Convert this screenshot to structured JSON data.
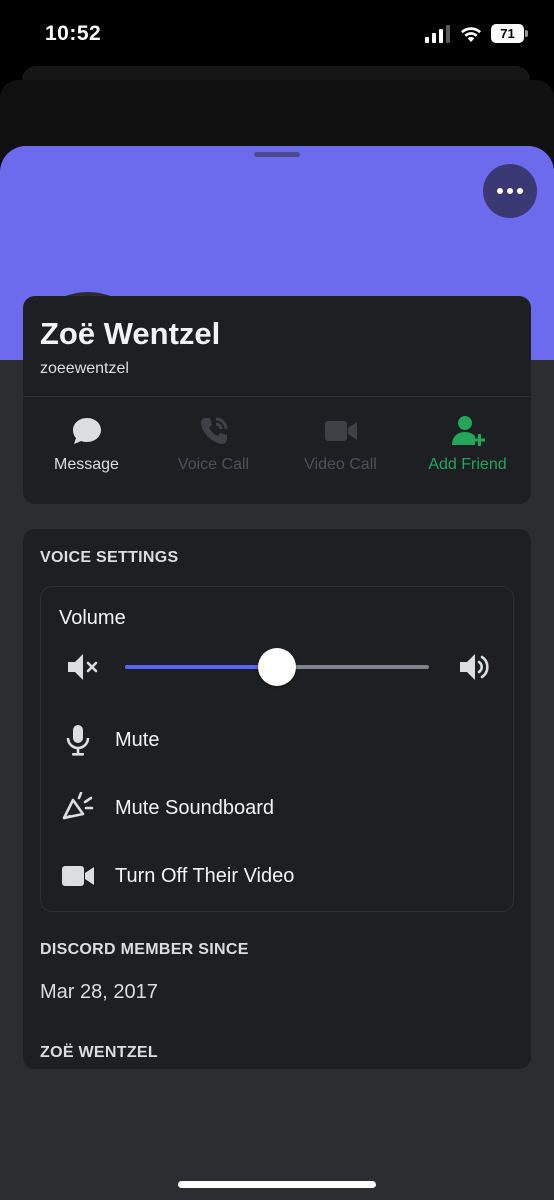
{
  "status_bar": {
    "time": "10:52",
    "battery": "71",
    "icons": [
      "cellular-signal-icon",
      "wifi-icon",
      "battery-icon"
    ]
  },
  "colors": {
    "banner": "#6c6bee",
    "accent": "#5865f2",
    "green": "#23a55a",
    "card": "#1e1f22",
    "sheet": "#2b2d31"
  },
  "profile": {
    "display_name": "Zoë Wentzel",
    "username": "zoeewentzel",
    "status": "offline",
    "more_icon": "ellipsis-icon"
  },
  "actions": [
    {
      "label": "Message",
      "icon": "chat-bubble-icon",
      "state": "enabled"
    },
    {
      "label": "Voice Call",
      "icon": "phone-icon",
      "state": "disabled"
    },
    {
      "label": "Video Call",
      "icon": "video-camera-icon",
      "state": "disabled"
    },
    {
      "label": "Add Friend",
      "icon": "add-friend-icon",
      "state": "accent"
    }
  ],
  "voice_settings": {
    "title": "VOICE SETTINGS",
    "volume_label": "Volume",
    "volume_value": 0.5,
    "items": [
      {
        "label": "Mute",
        "icon": "microphone-icon"
      },
      {
        "label": "Mute Soundboard",
        "icon": "soundboard-icon"
      },
      {
        "label": "Turn Off Their Video",
        "icon": "video-camera-icon"
      }
    ]
  },
  "member_since": {
    "title": "DISCORD MEMBER SINCE",
    "date": "Mar 28, 2017"
  },
  "next_section_title": "ZOË WENTZEL"
}
